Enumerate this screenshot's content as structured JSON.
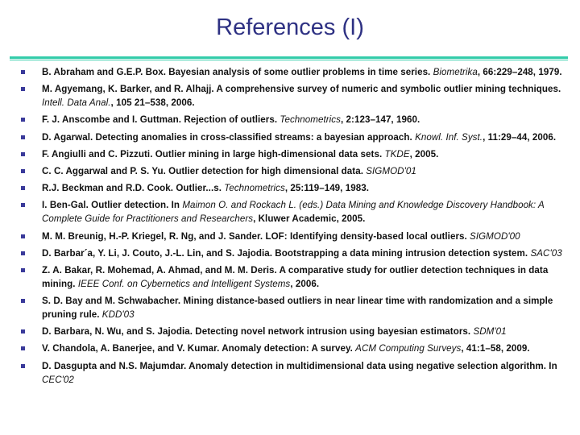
{
  "slide": {
    "title": "References (I)"
  },
  "colors": {
    "title": "#2e3183",
    "divider": "#33ccaa",
    "bullet": "#3a3a9a",
    "text": "#111111"
  },
  "references": [
    {
      "main": "B. Abraham and G.E.P. Box. Bayesian analysis of some outlier problems in time series. ",
      "venue": "Biometrika",
      "tail": ", 66:229–248, 1979."
    },
    {
      "main": "M. Agyemang, K. Barker, and R. Alhajj. A comprehensive survey of numeric and symbolic outlier mining techniques. ",
      "venue": "Intell. Data Anal.",
      "tail": ", 105 21–538, 2006."
    },
    {
      "main": "F. J. Anscombe and I. Guttman. Rejection of outliers. ",
      "venue": "Technometrics",
      "tail": ", 2:123–147, 1960."
    },
    {
      "main": "D. Agarwal. Detecting anomalies in cross-classified streams: a bayesian approach. ",
      "venue": "Knowl. Inf. Syst.",
      "tail": ", 11:29–44, 2006."
    },
    {
      "main": "F. Angiulli and C. Pizzuti. Outlier mining in large high-dimensional data sets. ",
      "venue": "TKDE",
      "tail": ", 2005."
    },
    {
      "main": "C. C. Aggarwal and P. S. Yu. Outlier detection for high dimensional data. ",
      "venue": "SIGMOD'01",
      "tail": ""
    },
    {
      "main": "R.J. Beckman and R.D. Cook. Outlier...s. ",
      "venue": "Technometrics",
      "tail": ", 25:119–149, 1983."
    },
    {
      "main": "I. Ben-Gal. Outlier detection. In ",
      "venue": "Maimon O. and Rockach L. (eds.) Data Mining and Knowledge Discovery Handbook: A Complete Guide for Practitioners and Researchers",
      "tail": ", Kluwer Academic, 2005."
    },
    {
      "main": "M. M. Breunig, H.-P. Kriegel, R. Ng, and J. Sander. LOF: Identifying density-based local outliers. ",
      "venue": "SIGMOD'00",
      "tail": ""
    },
    {
      "main": "D. Barbar´a, Y. Li, J. Couto, J.-L. Lin, and S. Jajodia. Bootstrapping a data mining intrusion detection system. ",
      "venue": "SAC'03",
      "tail": ""
    },
    {
      "main": "Z. A. Bakar, R. Mohemad, A. Ahmad, and M. M. Deris. A comparative study for outlier detection techniques in data mining. ",
      "venue": "IEEE Conf. on Cybernetics and Intelligent Systems",
      "tail": ", 2006."
    },
    {
      "main": "S. D. Bay and M. Schwabacher. Mining distance-based outliers in near linear time with randomization and a simple pruning rule. ",
      "venue": "KDD'03",
      "tail": ""
    },
    {
      "main": "D. Barbara, N. Wu, and S. Jajodia. Detecting novel network intrusion using bayesian estimators. ",
      "venue": "SDM'01",
      "tail": ""
    },
    {
      "main": "V. Chandola, A. Banerjee, and V. Kumar. Anomaly detection: A survey. ",
      "venue": "ACM Computing Surveys",
      "tail": ", 41:1–58, 2009."
    },
    {
      "main": "D. Dasgupta and N.S. Majumdar. Anomaly detection in multidimensional data using negative selection algorithm. In ",
      "venue": "CEC'02",
      "tail": ""
    }
  ]
}
